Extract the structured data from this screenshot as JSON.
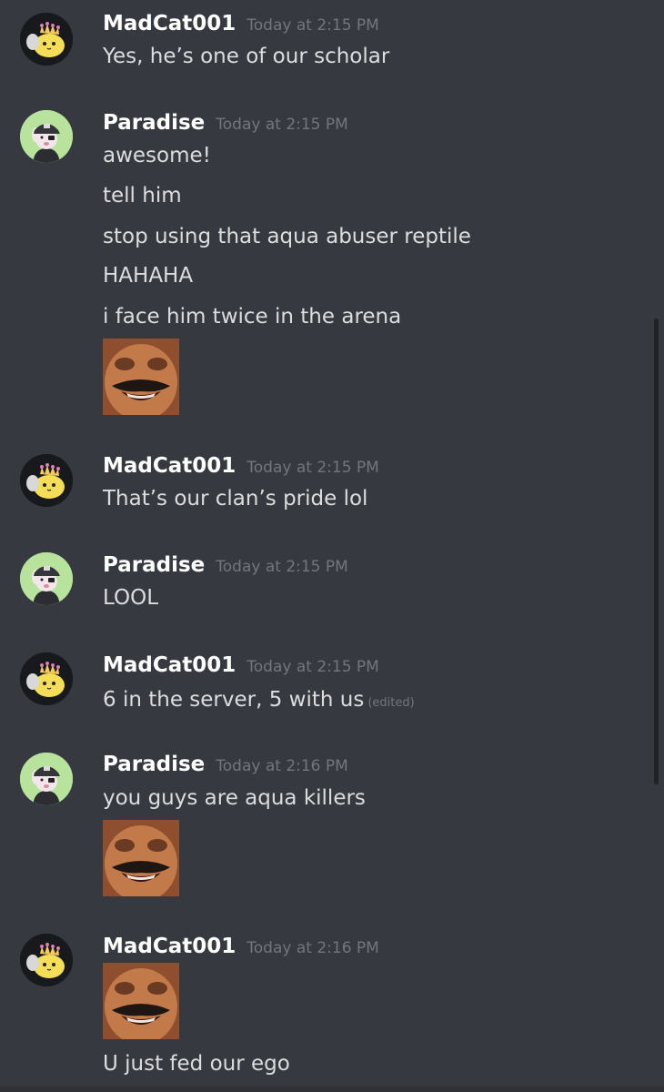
{
  "users": {
    "madcat": {
      "name": "MadCat001",
      "avatar_icon": "axie-avatar-icon"
    },
    "paradise": {
      "name": "Paradise",
      "avatar_icon": "panda-avatar-icon"
    }
  },
  "messages": [
    {
      "author": "MadCat001",
      "time": "Today at 2:15 PM",
      "lines": [
        "Yes, he’s one of our scholar"
      ]
    },
    {
      "author": "Paradise",
      "time": "Today at 2:15 PM",
      "lines": [
        "awesome!",
        "tell him",
        "stop using that aqua abuser reptile",
        "HAHAHA",
        "i face him twice in the arena"
      ],
      "emoji": "laughing-face-emoji"
    },
    {
      "author": "MadCat001",
      "time": "Today at 2:15 PM",
      "lines": [
        "That’s our clan’s pride lol"
      ]
    },
    {
      "author": "Paradise",
      "time": "Today at 2:15 PM",
      "lines": [
        "LOOL"
      ]
    },
    {
      "author": "MadCat001",
      "time": "Today at 2:15 PM",
      "lines": [
        "6 in the server, 5 with us"
      ],
      "edited_label": "(edited)"
    },
    {
      "author": "Paradise",
      "time": "Today at 2:16 PM",
      "lines": [
        "you guys are aqua killers"
      ],
      "emoji": "laughing-face-emoji"
    },
    {
      "author": "MadCat001",
      "time": "Today at 2:16 PM",
      "emoji": "laughing-face-emoji",
      "lines_after_emoji": [
        "U just fed our ego"
      ]
    }
  ],
  "colors": {
    "background": "#36393f",
    "username": "#ffffff",
    "timestamp": "#72767d",
    "message_text": "#dcddde",
    "scrollbar": "#202225"
  }
}
